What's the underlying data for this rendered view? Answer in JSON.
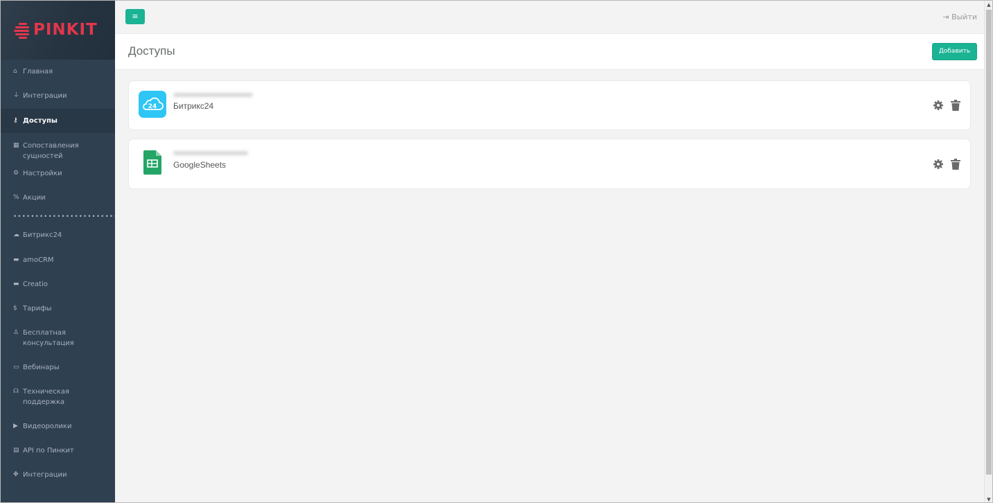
{
  "brand": {
    "logo_text": "PINKIT",
    "accent_color": "#e2364a"
  },
  "topbar": {
    "menu_icon": "bars-icon",
    "logout_label": "Выйти"
  },
  "page": {
    "title": "Доступы",
    "add_button": "Добавить"
  },
  "sidebar": {
    "items": [
      {
        "label": "Главная",
        "icon": "home-icon",
        "active": false
      },
      {
        "label": "Интеграции",
        "icon": "plug-icon",
        "active": false
      },
      {
        "label": "Доступы",
        "icon": "key-icon",
        "active": true
      },
      {
        "label": "Сопоставления сущностей",
        "icon": "table-icon",
        "active": false
      },
      {
        "label": "Настройки",
        "icon": "cogs-icon",
        "active": false
      },
      {
        "label": "Акции",
        "icon": "percent-icon",
        "active": false
      },
      {
        "label": "Битрикс24",
        "icon": "cloud-icon",
        "active": false
      },
      {
        "label": "amoCRM",
        "icon": "hdd-icon",
        "active": false
      },
      {
        "label": "Creatio",
        "icon": "hdd-icon",
        "active": false
      },
      {
        "label": "Тарифы",
        "icon": "dollar-icon",
        "active": false
      },
      {
        "label": "Бесплатная консультация",
        "icon": "user-tie-icon",
        "active": false
      },
      {
        "label": "Вебинары",
        "icon": "chalkboard-icon",
        "active": false
      },
      {
        "label": "Техническая поддержка",
        "icon": "headset-icon",
        "active": false
      },
      {
        "label": "Видеоролики",
        "icon": "youtube-icon",
        "active": false
      },
      {
        "label": "API по Пинкит",
        "icon": "file-code-icon",
        "active": false
      },
      {
        "label": "Интеграции",
        "icon": "puzzle-icon",
        "active": false
      }
    ],
    "separator": "•••••••••••••••••••••••••••••••"
  },
  "accesses": [
    {
      "name": "Битрикс24",
      "logo": "bitrix24-cloud-icon",
      "logo_text": "24"
    },
    {
      "name": "GoogleSheets",
      "logo": "google-sheets-icon"
    }
  ]
}
